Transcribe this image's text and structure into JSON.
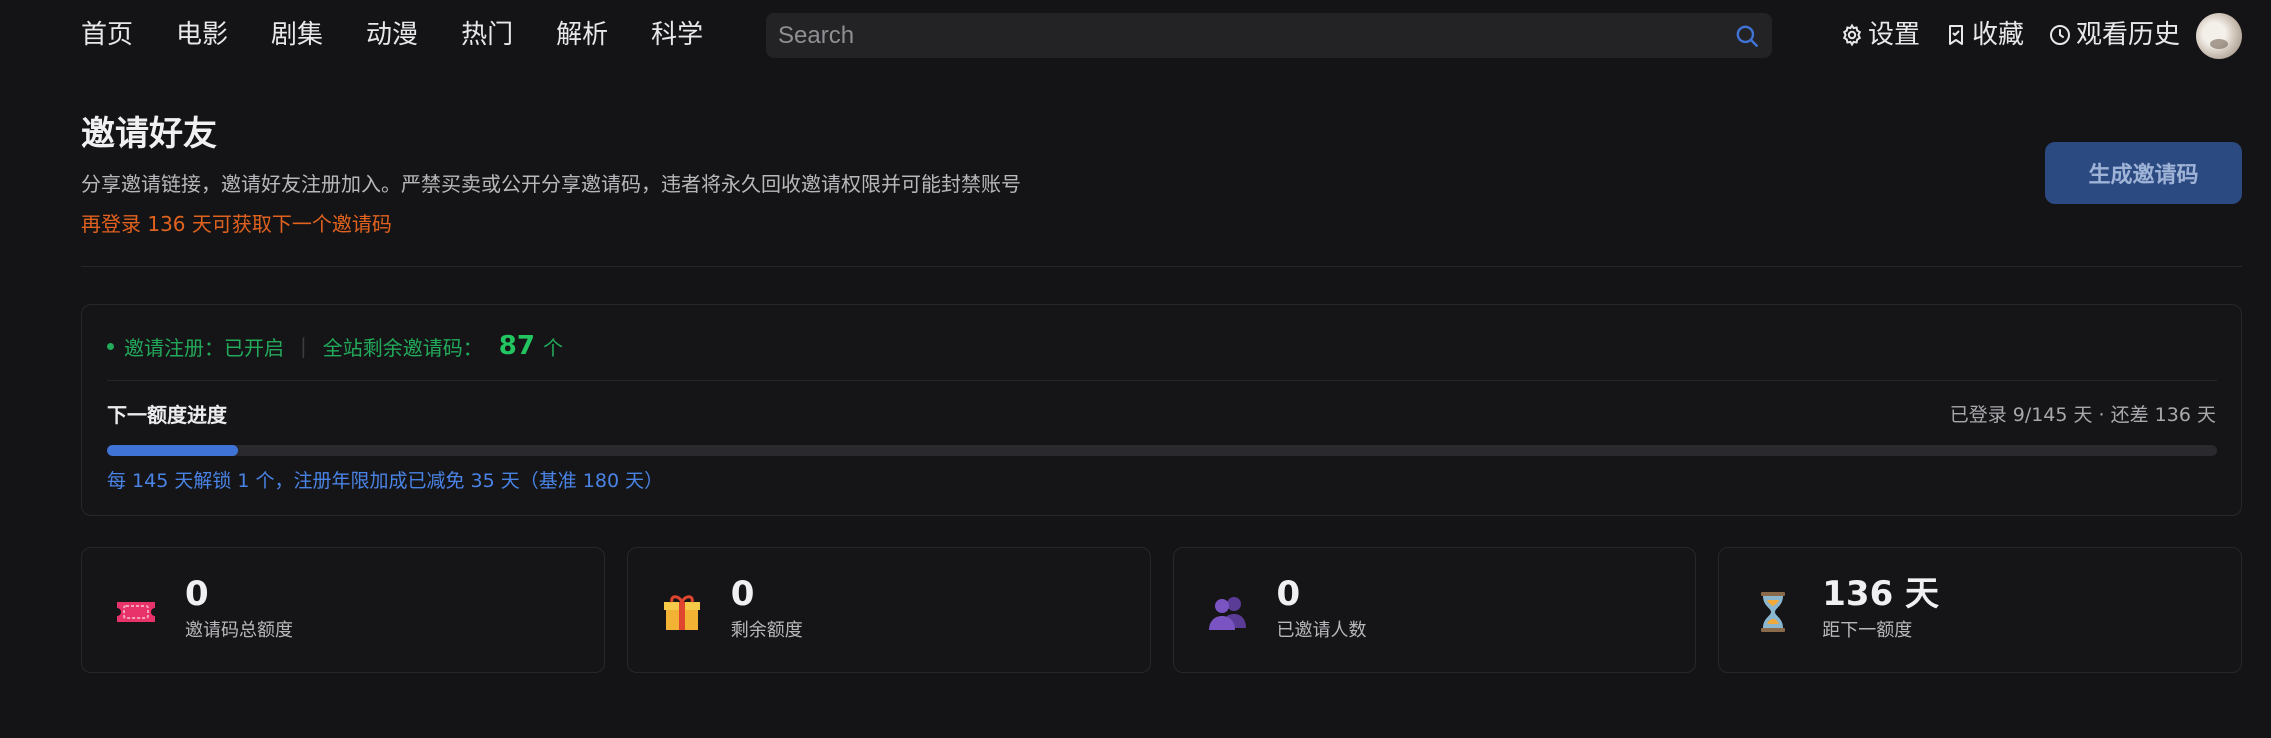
{
  "nav": {
    "items": [
      "首页",
      "电影",
      "剧集",
      "动漫",
      "热门",
      "解析",
      "科学"
    ]
  },
  "search": {
    "placeholder": "Search"
  },
  "top_actions": {
    "settings": "设置",
    "favorites": "收藏",
    "history": "观看历史"
  },
  "header": {
    "title": "邀请好友",
    "description": "分享邀请链接，邀请好友注册加入。严禁买卖或公开分享邀请码，违者将永久回收邀请权限并可能封禁账号",
    "notice": "再登录 136 天可获取下一个邀请码",
    "generate_button": "生成邀请码"
  },
  "status": {
    "registration": "邀请注册：已开启",
    "remaining_label": "全站剩余邀请码：",
    "remaining_count": "87",
    "remaining_unit": "个"
  },
  "progress": {
    "title": "下一额度进度",
    "meta": "已登录 9/145 天 · 还差 136 天",
    "fraction": 0.062,
    "note": "每 145 天解锁 1 个，注册年限加成已减免 35 天（基准 180 天）"
  },
  "stats": [
    {
      "value": "0",
      "label": "邀请码总额度",
      "icon": "ticket-icon"
    },
    {
      "value": "0",
      "label": "剩余额度",
      "icon": "gift-icon"
    },
    {
      "value": "0",
      "label": "已邀请人数",
      "icon": "users-icon"
    },
    {
      "value": "136 天",
      "label": "距下一额度",
      "icon": "hourglass-icon"
    }
  ],
  "colors": {
    "accent_blue": "#3f74d6",
    "success_green": "#22a95a",
    "warning_orange": "#e0621e",
    "button_bg": "#2b4a82"
  }
}
